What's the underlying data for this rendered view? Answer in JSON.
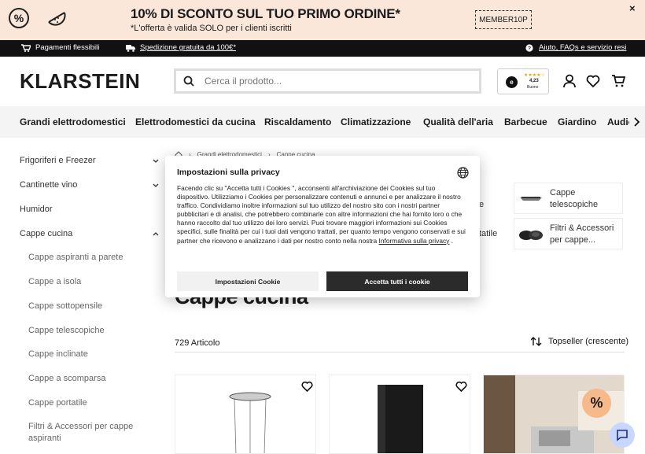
{
  "promo": {
    "title": "10% DI SCONTO SUL TUO PRIMO ORDINE*",
    "subtitle": "*L'offerta è valida SOLO per i clienti iscritti",
    "code": "MEMBER10P",
    "percent_symbol": "%",
    "close": "×"
  },
  "infobar": {
    "payments": "Pagamenti flessibili",
    "shipping": "Spedizione gratuita da 100€*",
    "help": "Aiuto, FAQs e servizio resi"
  },
  "header": {
    "logo": "KLARSTEIN",
    "search_placeholder": "Cerca il prodotto...",
    "rating": {
      "badge": "e",
      "stars": "★★★★☆",
      "score": "4,23",
      "label": "Buono"
    }
  },
  "nav": {
    "items": [
      "Grandi elettrodomestici",
      "Elettrodomestici da cucina",
      "Riscaldamento",
      "Climatizzazione",
      "Qualità dell'aria",
      "Barbecue",
      "Giardino",
      "Audio"
    ]
  },
  "sidebar": {
    "items": [
      "Frigoriferi e Freezer",
      "Cantinette vino",
      "Humidor",
      "Cappe cucina"
    ],
    "subitems": [
      "Cappe aspiranti a parete",
      "Cappe a isola",
      "Cappe sottopensile",
      "Cappe telescopiche",
      "Cappe inclinate",
      "Cappe a scomparsa",
      "Cappe portatile",
      "Filtri & Accessori per cappe aspiranti"
    ]
  },
  "breadcrumb": [
    "Grandi elettrodomestici",
    "Cappe cucina"
  ],
  "categories": {
    "card1": "Cappe telescopiche",
    "card2": "Filtri & Accessori per cappe...",
    "frag1": "e",
    "frag2": "tatile"
  },
  "main": {
    "title": "Cappe cucina",
    "count": "729 Articolo",
    "sort": "Topseller (crescente)",
    "discount_badge": "%"
  },
  "privacy": {
    "title": "Impostazioni sulla privacy",
    "text": "Facendo clic su \"Accetta tutti i Cookies \", acconsenti all'archiviazione dei Cookies sul tuo dispositivo. Utilizziamo i Cookies per personalizzare contenuti e annunci e per analizzare il nostro traffico. Condividiamo inoltre informazioni sul tuo utilizzo del nostro sito con i nostri partner pubblicitari e di analisi, che potrebbero combinarle con altre informazioni che hai fornito loro o che hanno raccolto dal tuo utilizzo dei loro servizi. Puoi trovare maggiori informazioni sui Cookies specifici, sulle finalità per cui i tuoi dati vengono trattati, per quanto tempo vengono conservati e sui partner che ricevono e analizzano i dati per nostro conto nella nostra ",
    "link": "Informativa sulla privacy",
    "text_end": " .",
    "settings_button": "Impostazioni Cookie",
    "accept_button": "Accetta tutti i cookie"
  }
}
